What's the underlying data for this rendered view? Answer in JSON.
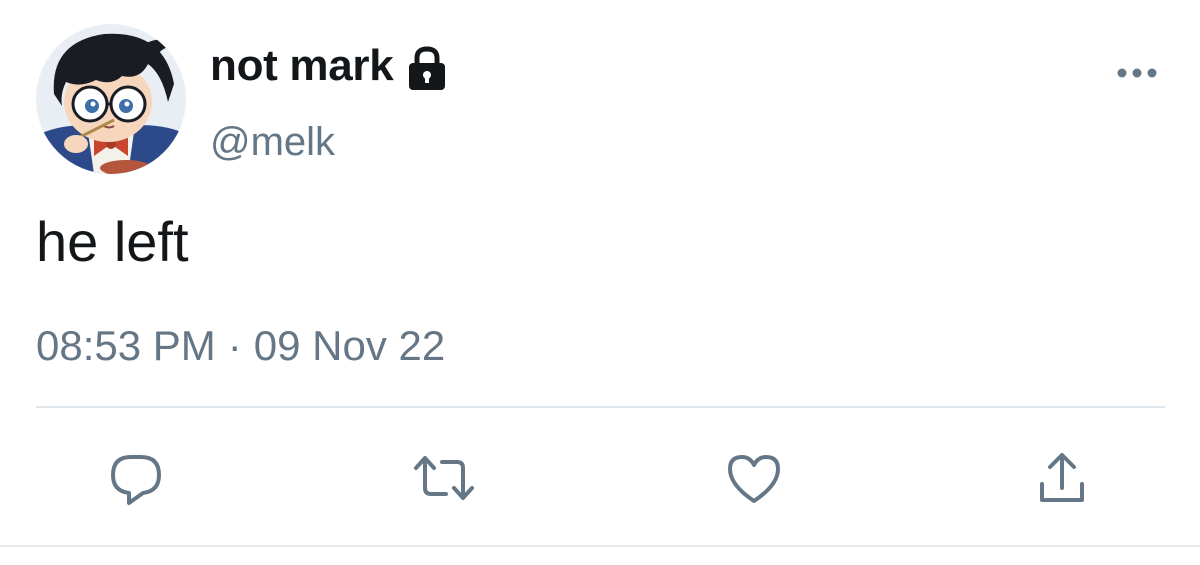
{
  "tweet": {
    "display_name": "not mark",
    "handle": "@melk",
    "protected_icon": "lock-icon",
    "avatar_icon": "avatar-anime-character",
    "text": "he left",
    "time": "08:53 PM",
    "separator": "·",
    "date": "09 Nov 22"
  },
  "actions": {
    "reply_icon": "reply-icon",
    "retweet_icon": "retweet-icon",
    "like_icon": "heart-icon",
    "share_icon": "share-icon"
  },
  "colors": {
    "text_primary": "#14171a",
    "text_secondary": "#657786",
    "icon": "#657786",
    "divider": "#e1e8ed"
  }
}
